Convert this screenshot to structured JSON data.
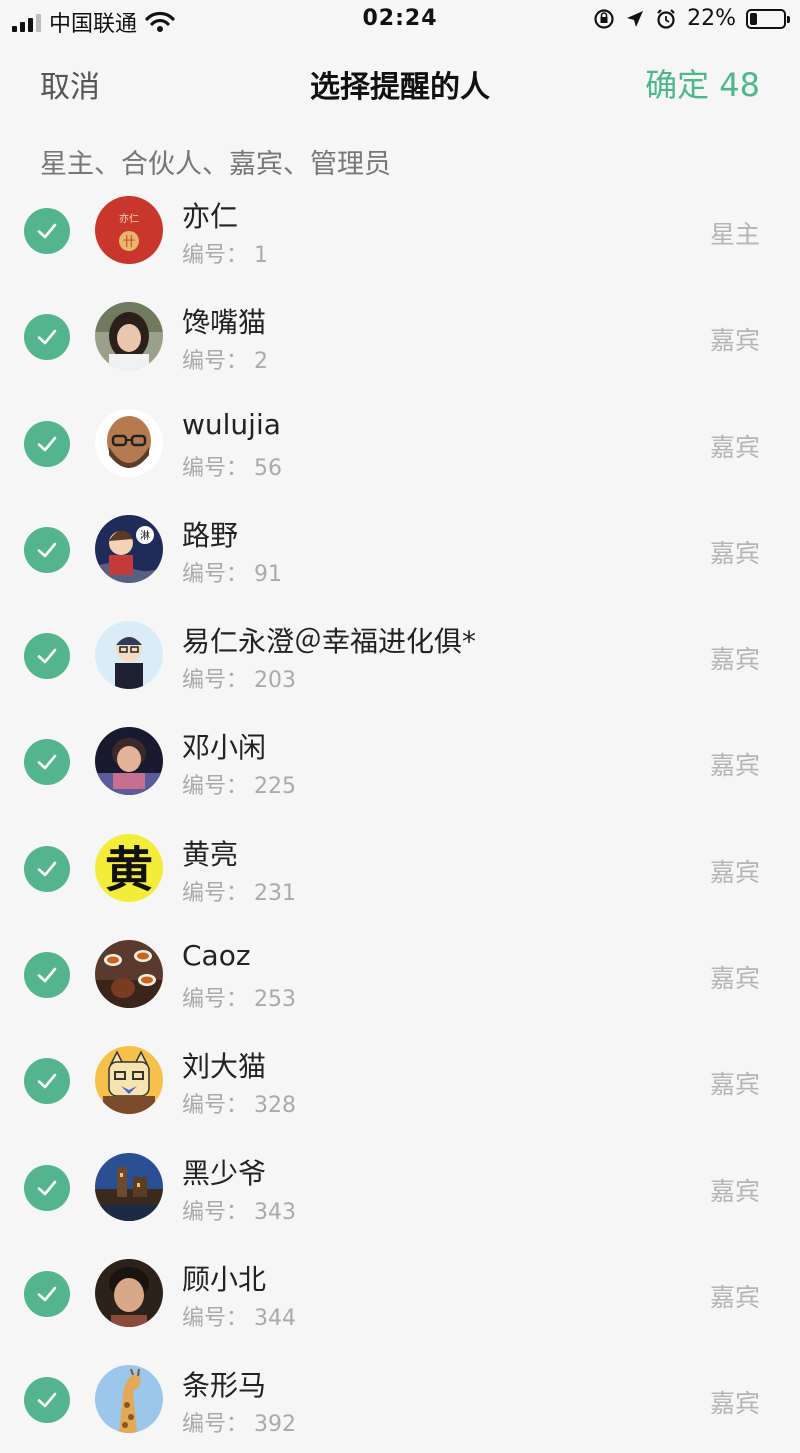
{
  "status_bar": {
    "carrier": "中国联通",
    "time": "02:24",
    "battery": "22%",
    "battery_level": 0.22
  },
  "nav": {
    "cancel_label": "取消",
    "title": "选择提醒的人",
    "confirm_label": "确定 48"
  },
  "section": {
    "header": "星主、合伙人、嘉宾、管理员"
  },
  "number_label": "编号：",
  "members": [
    {
      "name": "亦仁",
      "number": "1",
      "role": "星主",
      "avatar": "yiren-avatar"
    },
    {
      "name": "馋嘴猫",
      "number": "2",
      "role": "嘉宾",
      "avatar": "woman-photo-avatar"
    },
    {
      "name": "wulujia",
      "number": "56",
      "role": "嘉宾",
      "avatar": "bald-bearded-man-avatar"
    },
    {
      "name": "路野",
      "number": "91",
      "role": "嘉宾",
      "avatar": "cartoon-man-avatar"
    },
    {
      "name": "易仁永澄＠幸福进化俱*",
      "number": "203",
      "role": "嘉宾",
      "avatar": "cartoon-glasses-man-avatar"
    },
    {
      "name": "邓小闲",
      "number": "225",
      "role": "嘉宾",
      "avatar": "woman-portrait-avatar"
    },
    {
      "name": "黄亮",
      "number": "231",
      "role": "嘉宾",
      "avatar": "huang-character-avatar"
    },
    {
      "name": "Caoz",
      "number": "253",
      "role": "嘉宾",
      "avatar": "tea-cups-avatar"
    },
    {
      "name": "刘大猫",
      "number": "328",
      "role": "嘉宾",
      "avatar": "cartoon-cat-avatar"
    },
    {
      "name": "黑少爷",
      "number": "343",
      "role": "嘉宾",
      "avatar": "night-castle-avatar"
    },
    {
      "name": "顾小北",
      "number": "344",
      "role": "嘉宾",
      "avatar": "boy-photo-avatar"
    },
    {
      "name": "条形马",
      "number": "392",
      "role": "嘉宾",
      "avatar": "giraffe-avatar"
    }
  ],
  "colors": {
    "accent": "#4fb68c",
    "check": "#53b48d",
    "background": "#f6f6f6"
  },
  "avatar_text": {
    "yiren_top": "亦仁",
    "yiren_symbol": "卄",
    "luye_badge": "淋",
    "huang": "黄"
  }
}
